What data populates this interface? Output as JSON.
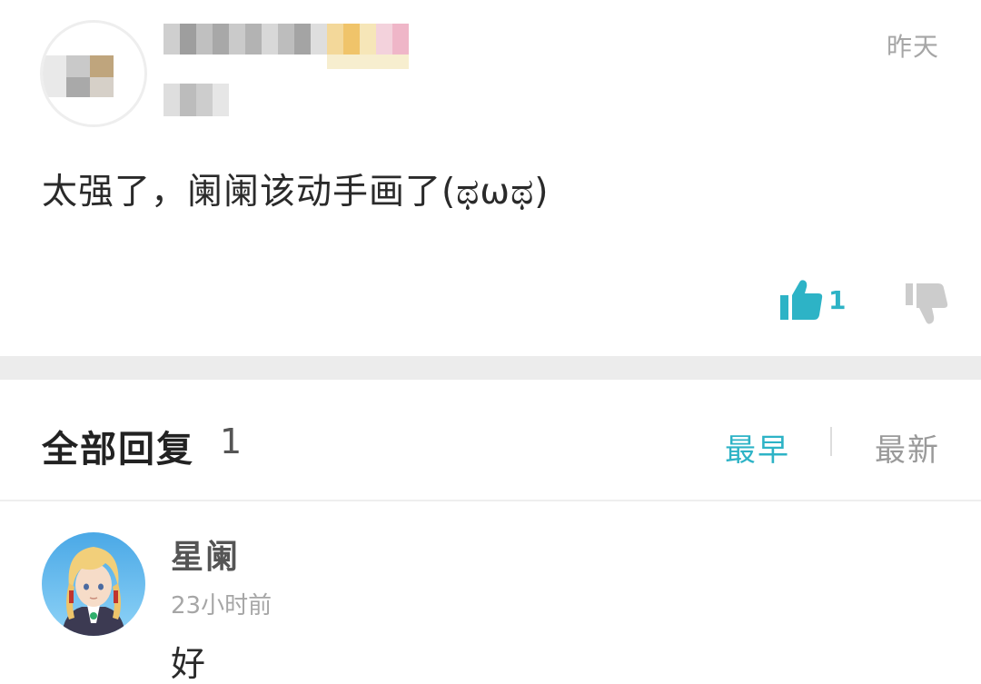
{
  "main_comment": {
    "timestamp": "昨天",
    "text": "太强了，阑阑该动手画了(ಥωಥ)",
    "like_count": "1",
    "like_icon": "thumbs-up-icon",
    "dislike_icon": "thumbs-down-icon"
  },
  "replies": {
    "title": "全部回复",
    "count": "1",
    "sort_earliest": "最早",
    "sort_newest": "最新",
    "items": [
      {
        "author": "星阑",
        "time": "23小时前",
        "text": "好"
      }
    ]
  },
  "colors": {
    "accent": "#2db3c6",
    "muted_text": "#a6a6a6",
    "separator": "#ececec"
  }
}
